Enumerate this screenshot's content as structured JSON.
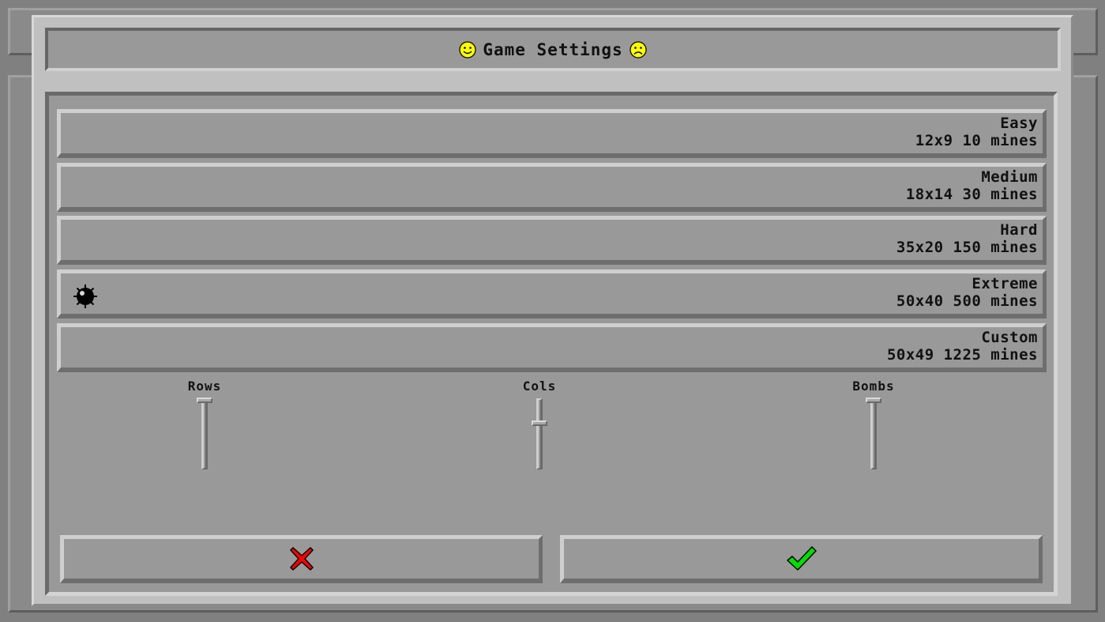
{
  "dialog": {
    "title": "Game Settings"
  },
  "presets": [
    {
      "name": "Easy",
      "detail": "12x9 10 mines",
      "selected": false
    },
    {
      "name": "Medium",
      "detail": "18x14 30 mines",
      "selected": false
    },
    {
      "name": "Hard",
      "detail": "35x20 150 mines",
      "selected": false
    },
    {
      "name": "Extreme",
      "detail": "50x40 500 mines",
      "selected": true
    },
    {
      "name": "Custom",
      "detail": "50x49 1225 mines",
      "selected": false
    }
  ],
  "sliders": {
    "rows": {
      "label": "Rows"
    },
    "cols": {
      "label": "Cols"
    },
    "bombs": {
      "label": "Bombs"
    }
  },
  "buttons": {
    "cancel_icon": "red-x-icon",
    "confirm_icon": "green-check-icon"
  },
  "colors": {
    "cancel": "#ff0000",
    "confirm": "#00e000",
    "face": "#ffff00"
  }
}
